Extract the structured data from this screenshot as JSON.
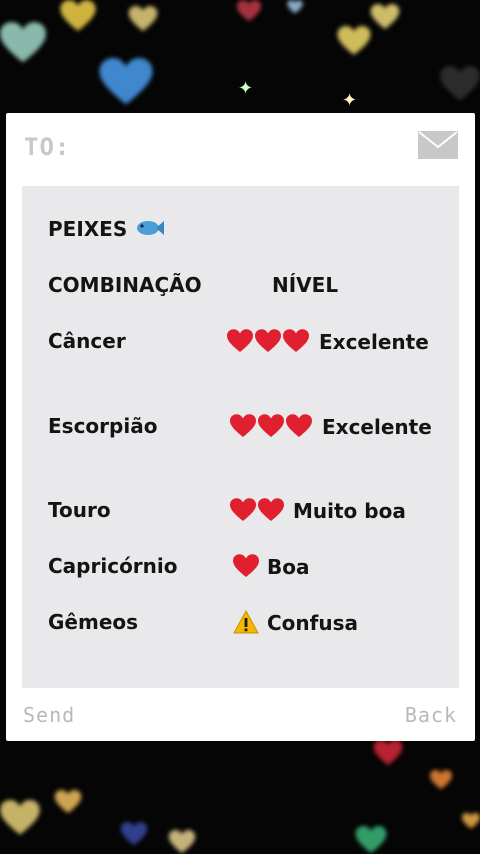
{
  "card": {
    "to_label": "TO:",
    "send_label": "Send",
    "back_label": "Back"
  },
  "content": {
    "title": "PEIXES",
    "title_icon": "fish-icon",
    "col_match": "COMBINAÇÃO",
    "col_level": "NÍVEL",
    "rows": [
      {
        "sign": "Câncer",
        "hearts": 3,
        "level": "Excelente",
        "icon": "heart-icon"
      },
      {
        "sign": "Escorpião",
        "hearts": 3,
        "level": "Excelente",
        "icon": "heart-icon"
      },
      {
        "sign": "Touro",
        "hearts": 2,
        "level": "Muito boa",
        "icon": "heart-icon"
      },
      {
        "sign": "Capricórnio",
        "hearts": 1,
        "level": "Boa",
        "icon": "heart-icon"
      },
      {
        "sign": "Gêmeos",
        "hearts": 0,
        "level": "Confusa",
        "icon": "warning-icon"
      }
    ]
  },
  "colors": {
    "heart": "#e0202e",
    "warning": "#f5b800",
    "background": "#050505"
  }
}
